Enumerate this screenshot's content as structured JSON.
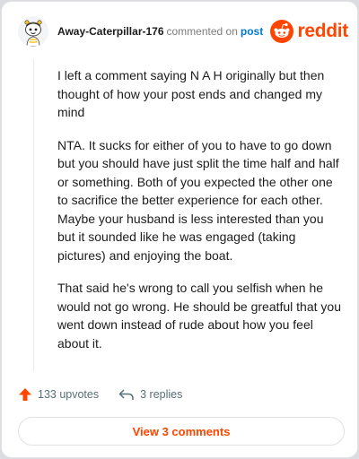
{
  "comment": {
    "username": "Away-Caterpillar-176",
    "action_text": "commented on",
    "post_link": "post",
    "paragraphs": [
      "I left a comment saying N A H originally but then thought of how your post ends and changed my mind",
      "NTA. It sucks for either of you to have to go down but you should have just split the time half and half or something. Both of you expected the other one to sacrifice the better experience for each other. Maybe your husband is less interested than you but it sounded like he was engaged (taking pictures) and enjoying the boat.",
      "That said he's wrong to call you selfish when he would not go wrong. He should be greatful that you went down instead of rude about how you feel about it."
    ],
    "upvotes": "133 upvotes",
    "replies": "3 replies"
  },
  "brand": {
    "name": "reddit",
    "color": "#ff4500"
  },
  "view_button": "View 3 comments",
  "icons": {
    "avatar": "snoo-avatar-icon",
    "logo": "reddit-logo-icon",
    "upvote": "upvote-arrow-icon",
    "reply": "reply-arrow-icon"
  },
  "colors": {
    "accent": "#ff4500",
    "link": "#0079d3",
    "muted": "#7c7c7c"
  }
}
